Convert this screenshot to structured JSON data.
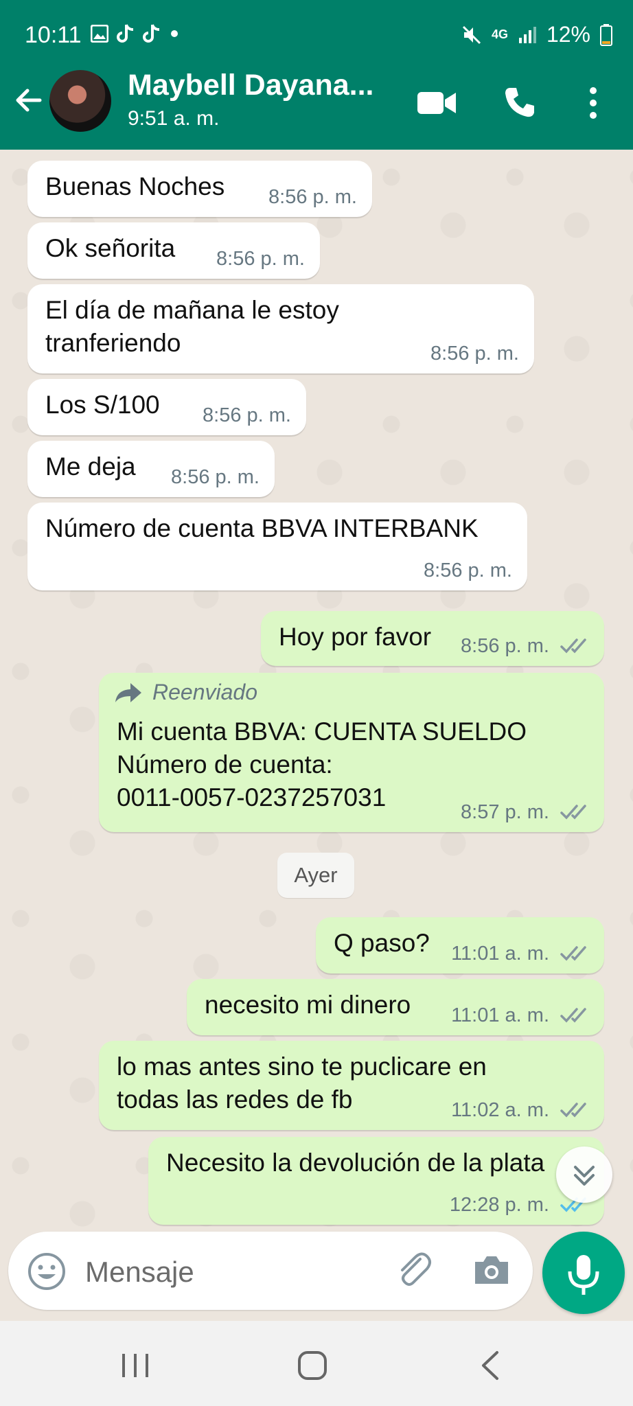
{
  "status_bar": {
    "time": "10:11",
    "battery": "12%",
    "network": "4G"
  },
  "header": {
    "contact_name": "Maybell Dayana...",
    "last_seen": "9:51 a. m."
  },
  "messages": [
    {
      "direction": "in",
      "text": "Buenas Noches",
      "time": "8:56 p. m."
    },
    {
      "direction": "in",
      "text": "Ok señorita",
      "time": "8:56 p. m."
    },
    {
      "direction": "in",
      "text": "El día de mañana le estoy\ntranferiendo",
      "time": "8:56 p. m."
    },
    {
      "direction": "in",
      "text": "Los S/100",
      "time": "8:56 p. m."
    },
    {
      "direction": "in",
      "text": "Me deja",
      "time": "8:56 p. m."
    },
    {
      "direction": "in",
      "text": "Número de cuenta BBVA INTERBANK",
      "time": "8:56 p. m."
    },
    {
      "direction": "out",
      "text": "Hoy por favor",
      "time": "8:56 p. m.",
      "status": "read"
    },
    {
      "direction": "out",
      "forwarded_label": "Reenviado",
      "text": "Mi cuenta BBVA: CUENTA SUELDO\nNúmero de cuenta:\n0011-0057-0237257031",
      "time": "8:57 p. m.",
      "status": "read"
    },
    {
      "direction": "out",
      "text": "Q paso?",
      "time": "11:01 a. m.",
      "status": "read"
    },
    {
      "direction": "out",
      "text": "necesito mi dinero",
      "time": "11:01 a. m.",
      "status": "read"
    },
    {
      "direction": "out",
      "text": "lo mas antes sino te puclicare en\ntodas las redes de fb",
      "time": "11:02 a. m.",
      "status": "read"
    },
    {
      "direction": "out",
      "text": "Necesito la devolución de la plata",
      "time": "12:28 p. m.",
      "status": "read-blue"
    }
  ],
  "date_separator": "Ayer",
  "composer": {
    "placeholder": "Mensaje"
  },
  "colors": {
    "header": "#008069",
    "outgoing_bubble": "#dcf8c6",
    "incoming_bubble": "#ffffff",
    "mic_button": "#00a884",
    "read_tick_blue": "#53bdeb",
    "read_tick_grey": "#8696a0"
  },
  "icons": [
    "gallery-icon",
    "tiktok-icon",
    "mute-icon",
    "signal-icon",
    "battery-icon",
    "back-arrow-icon",
    "video-call-icon",
    "phone-icon",
    "more-options-icon",
    "forward-icon",
    "double-check-icon",
    "scroll-down-icon",
    "emoji-icon",
    "attach-icon",
    "camera-icon",
    "mic-icon",
    "nav-recents-icon",
    "nav-home-icon",
    "nav-back-icon"
  ]
}
